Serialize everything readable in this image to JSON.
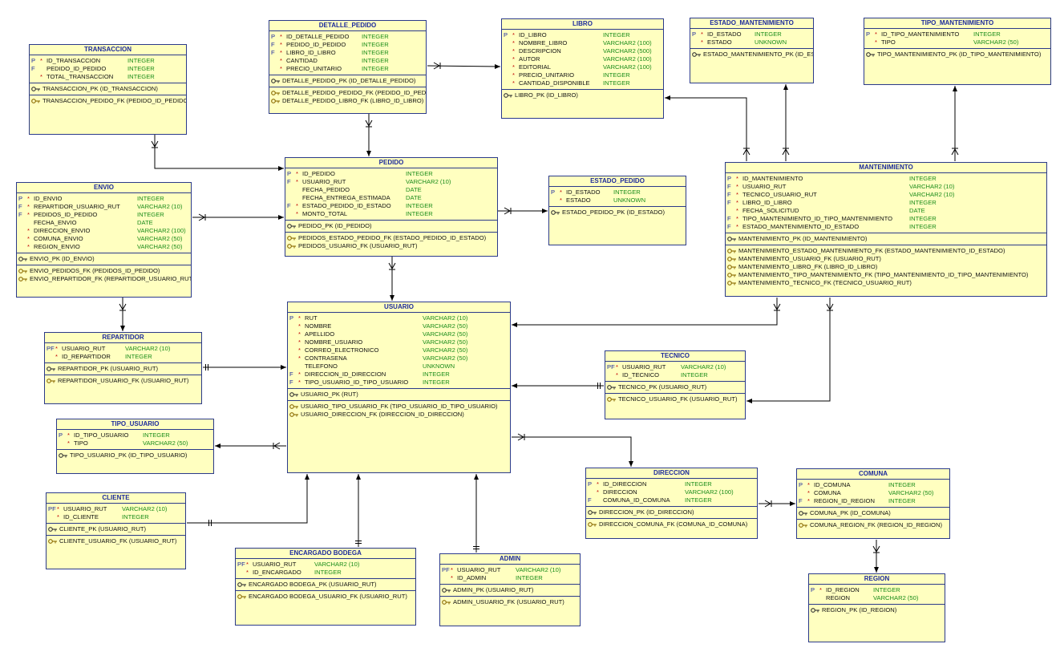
{
  "colors": {
    "entity_fill": "#ffffc0",
    "entity_border": "#2b3a8a",
    "title": "#1c2a9c",
    "type": "#1a8c1a",
    "mandatory": "#c00000",
    "line": "#000000"
  },
  "entities": [
    {
      "id": "detalle_pedido",
      "title": "DETALLE_PEDIDO",
      "type_col": 115,
      "cols": [
        [
          "P",
          "*",
          "ID_DETALLE_PEDIDO",
          "INTEGER"
        ],
        [
          "F",
          "*",
          "PEDIDO_ID_PEDIDO",
          "INTEGER"
        ],
        [
          "F",
          "*",
          "LIBRO_ID_LIBRO",
          "INTEGER"
        ],
        [
          "",
          "*",
          "CANTIDAD",
          "INTEGER"
        ],
        [
          "",
          "*",
          "PRECIO_UNITARIO",
          "INTEGER"
        ]
      ],
      "pks": [
        "DETALLE_PEDIDO_PK (ID_DETALLE_PEDIDO)"
      ],
      "fks": [
        "DETALLE_PEDIDO_PEDIDO_FK (PEDIDO_ID_PEDIDO)",
        "DETALLE_PEDIDO_LIBRO_FK (LIBRO_ID_LIBRO)"
      ]
    },
    {
      "id": "libro",
      "title": "LIBRO",
      "type_col": 126,
      "cols": [
        [
          "P",
          "*",
          "ID_LIBRO",
          "INTEGER"
        ],
        [
          "",
          "*",
          "NOMBRE_LIBRO",
          "VARCHAR2 (100)"
        ],
        [
          "",
          "*",
          "DESCRIPCION",
          "VARCHAR2 (500)"
        ],
        [
          "",
          "*",
          "AUTOR",
          "VARCHAR2 (100)"
        ],
        [
          "",
          "*",
          "EDITORIAL",
          "VARCHAR2 (100)"
        ],
        [
          "",
          "*",
          "PRECIO_UNITARIO",
          "INTEGER"
        ],
        [
          "",
          "*",
          "CANTIDAD_DISPONIBLE",
          "INTEGER"
        ]
      ],
      "pks": [
        "LIBRO_PK (ID_LIBRO)"
      ],
      "fks": []
    },
    {
      "id": "estado_mantenimiento",
      "title": "ESTADO_MANTENIMIENTO",
      "type_col": 80,
      "cols": [
        [
          "P",
          "*",
          "ID_ESTADO",
          "INTEGER"
        ],
        [
          "",
          "*",
          "ESTADO",
          "UNKNOWN"
        ]
      ],
      "pks": [
        "ESTADO_MANTENIMIENTO_PK (ID_ESTADO)"
      ],
      "fks": []
    },
    {
      "id": "tipo_mantenimiento",
      "title": "TIPO_MANTENIMIENTO",
      "type_col": 136,
      "cols": [
        [
          "P",
          "*",
          "ID_TIPO_MANTENIMIENTO",
          "INTEGER"
        ],
        [
          "",
          "*",
          "TIPO",
          "VARCHAR2 (50)"
        ]
      ],
      "pks": [
        "TIPO_MANTENIMIENTO_PK (ID_TIPO_MANTENIMIENTO)"
      ],
      "fks": []
    },
    {
      "id": "transaccion",
      "title": "TRANSACCION",
      "type_col": 122,
      "cols": [
        [
          "P",
          "*",
          "ID_TRANSACCION",
          "INTEGER"
        ],
        [
          "F",
          "",
          "PEDIDO_ID_PEDIDO",
          "INTEGER"
        ],
        [
          "",
          "*",
          "TOTAL_TRANSACCION",
          "INTEGER"
        ]
      ],
      "pks": [
        "TRANSACCION_PK (ID_TRANSACCION)"
      ],
      "fks": [
        "TRANSACCION_PEDIDO_FK (PEDIDO_ID_PEDIDO)"
      ]
    },
    {
      "id": "pedido",
      "title": "PEDIDO",
      "type_col": 150,
      "cols": [
        [
          "P",
          "*",
          "ID_PEDIDO",
          "INTEGER"
        ],
        [
          "F",
          "*",
          "USUARIO_RUT",
          "VARCHAR2 (10)"
        ],
        [
          "",
          "",
          "FECHA_PEDIDO",
          "DATE"
        ],
        [
          "",
          "",
          "FECHA_ENTREGA_ESTIMADA",
          "DATE"
        ],
        [
          "F",
          "*",
          "ESTADO_PEDIDO_ID_ESTADO",
          "INTEGER"
        ],
        [
          "",
          "*",
          "MONTO_TOTAL",
          "INTEGER"
        ]
      ],
      "pks": [
        "PEDIDO_PK (ID_PEDIDO)"
      ],
      "fks": [
        "PEDIDOS_ESTADO_PEDIDO_FK (ESTADO_PEDIDO_ID_ESTADO)",
        "PEDIDOS_USUARIO_FK (USUARIO_RUT)"
      ]
    },
    {
      "id": "estado_pedido",
      "title": "ESTADO_PEDIDO",
      "type_col": 80,
      "cols": [
        [
          "P",
          "*",
          "ID_ESTADO",
          "INTEGER"
        ],
        [
          "",
          "*",
          "ESTADO",
          "UNKNOWN"
        ]
      ],
      "pks": [
        "ESTADO_PEDIDO_PK (ID_ESTADO)"
      ],
      "fks": []
    },
    {
      "id": "mantenimiento",
      "title": "MANTENIMIENTO",
      "type_col": 229,
      "cols": [
        [
          "P",
          "*",
          "ID_MANTENIMIENTO",
          "INTEGER"
        ],
        [
          "F",
          "*",
          "USUARIO_RUT",
          "VARCHAR2 (10)"
        ],
        [
          "F",
          "*",
          "TECNICO_USUARIO_RUT",
          "VARCHAR2 (10)"
        ],
        [
          "F",
          "*",
          "LIBRO_ID_LIBRO",
          "INTEGER"
        ],
        [
          "",
          "*",
          "FECHA_SOLICITUD",
          "DATE"
        ],
        [
          "F",
          "*",
          "TIPO_MANTENIMIENTO_ID_TIPO_MANTENIMIENTO",
          "INTEGER"
        ],
        [
          "F",
          "*",
          "ESTADO_MANTENIMIENTO_ID_ESTADO",
          "INTEGER"
        ]
      ],
      "pks": [
        "MANTENIMIENTO_PK (ID_MANTENIMIENTO)"
      ],
      "fks": [
        "MANTENIMIENTO_ESTADO_MANTENIMIENTO_FK (ESTADO_MANTENIMIENTO_ID_ESTADO)",
        "MANTENIMIENTO_USUARIO_FK (USUARIO_RUT)",
        "MANTENIMIENTO_LIBRO_FK (LIBRO_ID_LIBRO)",
        "MANTENIMIENTO_TIPO_MANTENIMIENTO_FK (TIPO_MANTENIMIENTO_ID_TIPO_MANTENIMIENTO)",
        "MANTENIMIENTO_TECNICO_FK (TECNICO_USUARIO_RUT)"
      ]
    },
    {
      "id": "envio",
      "title": "ENVIO",
      "type_col": 150,
      "cols": [
        [
          "P",
          "*",
          "ID_ENVIO",
          "INTEGER"
        ],
        [
          "F",
          "*",
          "REPARTIDOR_USUARIO_RUT",
          "VARCHAR2 (10)"
        ],
        [
          "F",
          "*",
          "PEDIDOS_ID_PEDIDO",
          "INTEGER"
        ],
        [
          "",
          "",
          "FECHA_ENVIO",
          "DATE"
        ],
        [
          "",
          "*",
          "DIRECCION_ENVIO",
          "VARCHAR2 (100)"
        ],
        [
          "",
          "*",
          "COMUNA_ENVIO",
          "VARCHAR2 (50)"
        ],
        [
          "",
          "*",
          "REGION_ENVIO",
          "VARCHAR2 (50)"
        ]
      ],
      "pks": [
        "ENVIO_PK (ID_ENVIO)"
      ],
      "fks": [
        "ENVIO_PEDIDOS_FK (PEDIDOS_ID_PEDIDO)",
        "ENVIO_REPARTIDOR_FK (REPARTIDOR_USUARIO_RUT)"
      ]
    },
    {
      "id": "usuario",
      "title": "USUARIO",
      "type_col": 168,
      "cols": [
        [
          "P",
          "*",
          "RUT",
          "VARCHAR2 (10)"
        ],
        [
          "",
          "*",
          "NOMBRE",
          "VARCHAR2 (50)"
        ],
        [
          "",
          "*",
          "APELLIDO",
          "VARCHAR2 (50)"
        ],
        [
          "",
          "*",
          "NOMBRE_USUARIO",
          "VARCHAR2 (50)"
        ],
        [
          "",
          "*",
          "CORREO_ELECTRONICO",
          "VARCHAR2 (50)"
        ],
        [
          "",
          "*",
          "CONTRASENA",
          "VARCHAR2 (50)"
        ],
        [
          "",
          "",
          "TELEFONO",
          "UNKNOWN"
        ],
        [
          "F",
          "*",
          "DIRECCION_ID_DIRECCION",
          "INTEGER"
        ],
        [
          "F",
          "*",
          "TIPO_USUARIO_ID_TIPO_USUARIO",
          "INTEGER"
        ]
      ],
      "pks": [
        "USUARIO_PK (RUT)"
      ],
      "fks": [
        "USUARIO_TIPO_USUARIO_FK (TIPO_USUARIO_ID_TIPO_USUARIO)",
        "USUARIO_DIRECCION_FK (DIRECCION_ID_DIRECCION)"
      ]
    },
    {
      "id": "repartidor",
      "title": "REPARTIDOR",
      "type_col": 100,
      "cols": [
        [
          "PF",
          "*",
          "USUARIO_RUT",
          "VARCHAR2 (10)"
        ],
        [
          "",
          "*",
          "ID_REPARTIDOR",
          "INTEGER"
        ]
      ],
      "pks": [
        "REPARTIDOR_PK (USUARIO_RUT)"
      ],
      "fks": [
        "REPARTIDOR_USUARIO_FK (USUARIO_RUT)"
      ]
    },
    {
      "id": "tecnico",
      "title": "TECNICO",
      "type_col": 94,
      "cols": [
        [
          "PF",
          "*",
          "USUARIO_RUT",
          "VARCHAR2 (10)"
        ],
        [
          "",
          "*",
          "ID_TECNICO",
          "INTEGER"
        ]
      ],
      "pks": [
        "TECNICO_PK (USUARIO_RUT)"
      ],
      "fks": [
        "TECNICO_USUARIO_FK (USUARIO_RUT)"
      ]
    },
    {
      "id": "tipo_usuario",
      "title": "TIPO_USUARIO",
      "type_col": 107,
      "cols": [
        [
          "P",
          "*",
          "ID_TIPO_USUARIO",
          "INTEGER"
        ],
        [
          "",
          "*",
          "TIPO",
          "VARCHAR2 (50)"
        ]
      ],
      "pks": [
        "TIPO_USUARIO_PK (ID_TIPO_USUARIO)"
      ],
      "fks": []
    },
    {
      "id": "cliente",
      "title": "CLIENTE",
      "type_col": 94,
      "cols": [
        [
          "PF",
          "*",
          "USUARIO_RUT",
          "VARCHAR2 (10)"
        ],
        [
          "",
          "*",
          "ID_CLIENTE",
          "INTEGER"
        ]
      ],
      "pks": [
        "CLIENTE_PK (USUARIO_RUT)"
      ],
      "fks": [
        "CLIENTE_USUARIO_FK (USUARIO_RUT)"
      ]
    },
    {
      "id": "encargado_bodega",
      "title": "ENCARGADO BODEGA",
      "type_col": 98,
      "cols": [
        [
          "PF",
          "*",
          "USUARIO_RUT",
          "VARCHAR2 (10)"
        ],
        [
          "",
          "*",
          "ID_ENCARGADO",
          "INTEGER"
        ]
      ],
      "pks": [
        "ENCARGADO BODEGA_PK (USUARIO_RUT)"
      ],
      "fks": [
        "ENCARGADO BODEGA_USUARIO_FK (USUARIO_RUT)"
      ]
    },
    {
      "id": "admin",
      "title": "ADMIN",
      "type_col": 94,
      "cols": [
        [
          "PF",
          "*",
          "USUARIO_RUT",
          "VARCHAR2 (10)"
        ],
        [
          "",
          "*",
          "ID_ADMIN",
          "INTEGER"
        ]
      ],
      "pks": [
        "ADMIN_PK (USUARIO_RUT)"
      ],
      "fks": [
        "ADMIN_USUARIO_FK (USUARIO_RUT)"
      ]
    },
    {
      "id": "direccion",
      "title": "DIRECCION",
      "type_col": 123,
      "cols": [
        [
          "P",
          "*",
          "ID_DIRECCION",
          "INTEGER"
        ],
        [
          "",
          "*",
          "DIRECCION",
          "VARCHAR2 (100)"
        ],
        [
          "F",
          "",
          "COMUNA_ID_COMUNA",
          "INTEGER"
        ]
      ],
      "pks": [
        "DIRECCION_PK (ID_DIRECCION)"
      ],
      "fks": [
        "DIRECCION_COMUNA_FK (COMUNA_ID_COMUNA)"
      ]
    },
    {
      "id": "comuna",
      "title": "COMUNA",
      "type_col": 114,
      "cols": [
        [
          "P",
          "*",
          "ID_COMUNA",
          "INTEGER"
        ],
        [
          "",
          "*",
          "COMUNA",
          "VARCHAR2 (50)"
        ],
        [
          "F",
          "*",
          "REGION_ID_REGION",
          "INTEGER"
        ]
      ],
      "pks": [
        "COMUNA_PK (ID_COMUNA)"
      ],
      "fks": [
        "COMUNA_REGION_FK (REGION_ID_REGION)"
      ]
    },
    {
      "id": "region",
      "title": "REGION",
      "type_col": 80,
      "cols": [
        [
          "P",
          "*",
          "ID_REGION",
          "INTEGER"
        ],
        [
          "",
          "",
          "REGION",
          "VARCHAR2 (50)"
        ]
      ],
      "pks": [
        "REGION_PK (ID_REGION)"
      ],
      "fks": []
    }
  ]
}
